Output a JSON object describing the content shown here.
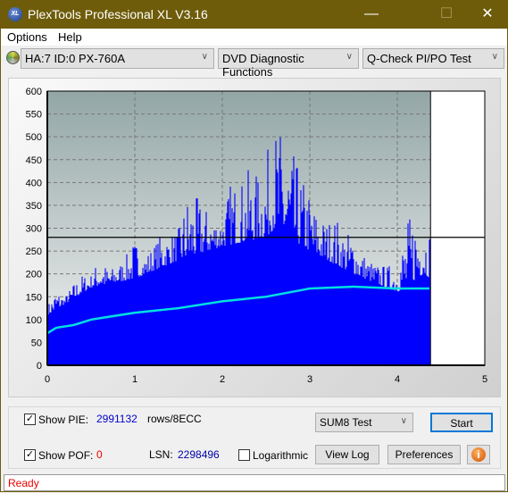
{
  "window": {
    "title": "PlexTools Professional XL V3.16",
    "logo_text": "XL",
    "minimize": "—",
    "maximize": "☐",
    "close": "✕"
  },
  "menu": {
    "options": "Options",
    "help": "Help"
  },
  "toolbar": {
    "drive": "HA:7 ID:0  PX-760A",
    "function": "DVD Diagnostic Functions",
    "test": "Q-Check PI/PO Test"
  },
  "chart_data": {
    "type": "bar",
    "xlim": [
      0,
      5
    ],
    "ylim": [
      0,
      600
    ],
    "x_ticks": [
      "0",
      "1",
      "2",
      "3",
      "4",
      "5"
    ],
    "y_ticks": [
      "0",
      "50",
      "100",
      "150",
      "200",
      "250",
      "300",
      "350",
      "400",
      "450",
      "500",
      "550",
      "600"
    ],
    "grid": true,
    "threshold": 280,
    "data_end_x": 4.38,
    "colors": {
      "pie": "#0000ff",
      "avg": "#00e0e0",
      "threshold": "#000000"
    },
    "pie_max_envelope": {
      "x": [
        0,
        0.1,
        0.2,
        0.3,
        0.4,
        0.5,
        0.6,
        0.7,
        0.8,
        0.9,
        1.0,
        1.1,
        1.2,
        1.3,
        1.4,
        1.5,
        1.6,
        1.7,
        1.8,
        1.9,
        2.0,
        2.1,
        2.2,
        2.3,
        2.4,
        2.5,
        2.6,
        2.7,
        2.8,
        2.9,
        3.0,
        3.1,
        3.2,
        3.3,
        3.4,
        3.5,
        3.6,
        3.7,
        3.8,
        3.9,
        4.0,
        4.1,
        4.2,
        4.3,
        4.38
      ],
      "y": [
        130,
        170,
        150,
        180,
        200,
        200,
        240,
        210,
        220,
        240,
        280,
        240,
        260,
        290,
        290,
        300,
        380,
        370,
        350,
        330,
        330,
        410,
        400,
        430,
        420,
        460,
        530,
        510,
        470,
        420,
        380,
        330,
        320,
        330,
        290,
        300,
        250,
        230,
        220,
        220,
        240,
        310,
        360,
        340,
        310
      ]
    },
    "pie_base": {
      "x": [
        0,
        0.5,
        1.0,
        1.5,
        2.0,
        2.5,
        2.6,
        3.0,
        3.5,
        4.0,
        4.3,
        4.38
      ],
      "y": [
        110,
        170,
        190,
        230,
        260,
        280,
        300,
        250,
        200,
        160,
        200,
        190
      ]
    },
    "avg_series": {
      "x": [
        0,
        0.1,
        0.2,
        0.3,
        0.5,
        1.0,
        1.5,
        2.0,
        2.5,
        3.0,
        3.5,
        4.0,
        4.38
      ],
      "y": [
        70,
        82,
        85,
        88,
        100,
        115,
        125,
        140,
        150,
        168,
        172,
        168,
        168
      ]
    }
  },
  "controls": {
    "show_pie_label": "Show PIE:",
    "pie_value": "2991132",
    "pie_unit": "rows/8ECC",
    "show_pof_label": "Show POF:",
    "pof_value": "0",
    "lsn_label": "LSN:",
    "lsn_value": "2298496",
    "log_label": "Logarithmic",
    "test_select": "SUM8 Test",
    "start": "Start",
    "view_log": "View Log",
    "preferences": "Preferences",
    "info_icon": "i"
  },
  "status": {
    "text": "Ready"
  }
}
